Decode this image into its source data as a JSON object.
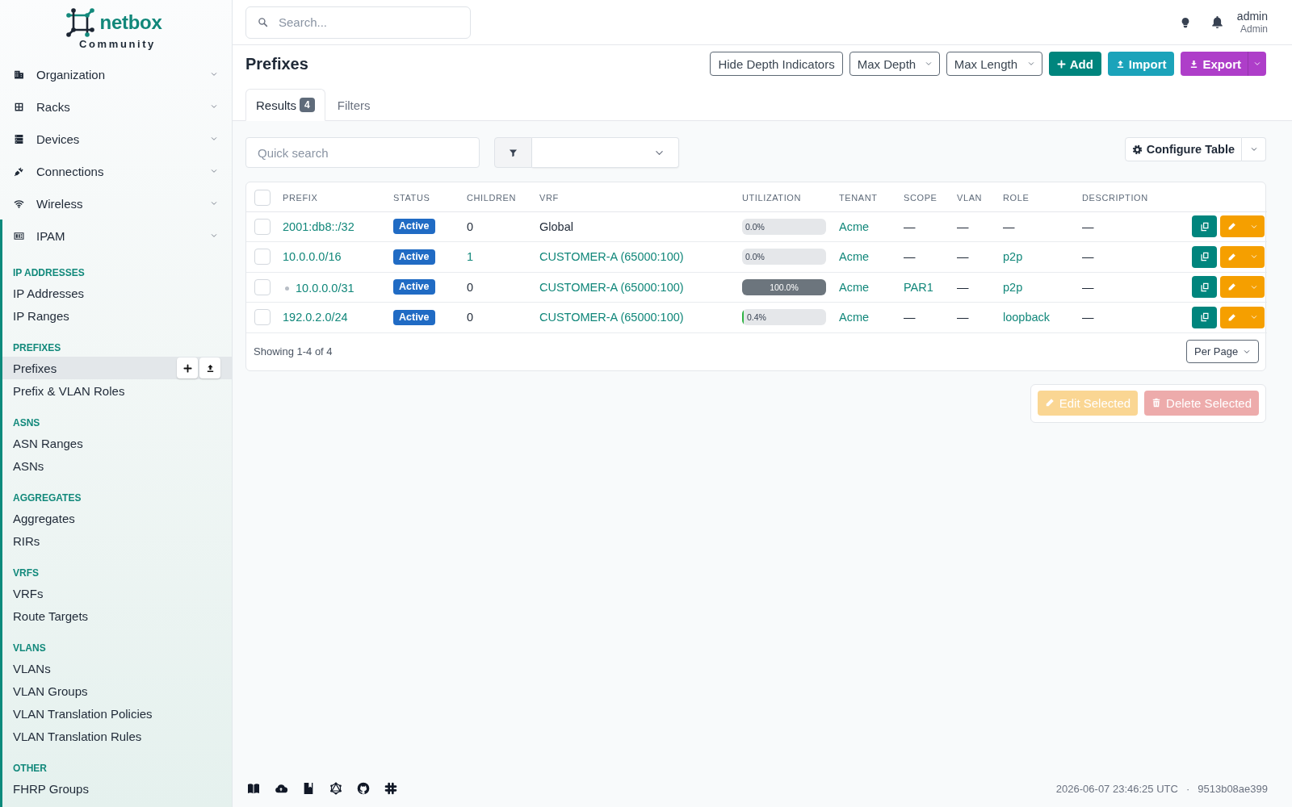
{
  "sidebar": {
    "logo": {
      "name": "netbox",
      "edition": "Community"
    },
    "menu": [
      {
        "label": "Organization",
        "expanded": false
      },
      {
        "label": "Racks",
        "expanded": false
      },
      {
        "label": "Devices",
        "expanded": false
      },
      {
        "label": "Connections",
        "expanded": false
      },
      {
        "label": "Wireless",
        "expanded": false
      },
      {
        "label": "IPAM",
        "expanded": true,
        "sections": [
          {
            "title": "IP ADDRESSES",
            "items": [
              {
                "label": "IP Addresses",
                "selected": false
              },
              {
                "label": "IP Ranges",
                "selected": false
              }
            ]
          },
          {
            "title": "PREFIXES",
            "items": [
              {
                "label": "Prefixes",
                "selected": true
              },
              {
                "label": "Prefix & VLAN Roles",
                "selected": false
              }
            ]
          },
          {
            "title": "ASNS",
            "items": [
              {
                "label": "ASN Ranges",
                "selected": false
              },
              {
                "label": "ASNs",
                "selected": false
              }
            ]
          },
          {
            "title": "AGGREGATES",
            "items": [
              {
                "label": "Aggregates",
                "selected": false
              },
              {
                "label": "RIRs",
                "selected": false
              }
            ]
          },
          {
            "title": "VRFS",
            "items": [
              {
                "label": "VRFs",
                "selected": false
              },
              {
                "label": "Route Targets",
                "selected": false
              }
            ]
          },
          {
            "title": "VLANS",
            "items": [
              {
                "label": "VLANs",
                "selected": false
              },
              {
                "label": "VLAN Groups",
                "selected": false
              },
              {
                "label": "VLAN Translation Policies",
                "selected": false
              },
              {
                "label": "VLAN Translation Rules",
                "selected": false
              }
            ]
          },
          {
            "title": "OTHER",
            "items": [
              {
                "label": "FHRP Groups",
                "selected": false
              }
            ]
          }
        ]
      }
    ]
  },
  "header": {
    "search": {
      "placeholder": "Search..."
    },
    "user": {
      "name": "admin",
      "role": "Admin"
    }
  },
  "page": {
    "title": "Prefixes",
    "actions": [
      {
        "kind": "toggle",
        "label": "Hide Depth Indicators"
      },
      {
        "kind": "select",
        "label": "Max Depth"
      },
      {
        "kind": "select",
        "label": "Max Length"
      },
      {
        "kind": "add",
        "label": "Add"
      },
      {
        "kind": "import",
        "label": "Import"
      },
      {
        "kind": "export",
        "label": "Export"
      }
    ],
    "tabs": [
      {
        "label": "Results",
        "badge": "4",
        "selected": true
      },
      {
        "label": "Filters",
        "selected": false
      }
    ]
  },
  "toolbar": {
    "quick_search": {
      "placeholder": "Quick search"
    },
    "configure": "Configure Table"
  },
  "table": {
    "select_all": {
      "checked": false
    },
    "columns": [
      "PREFIX",
      "STATUS",
      "CHILDREN",
      "VRF",
      "UTILIZATION",
      "TENANT",
      "SCOPE",
      "VLAN",
      "ROLE",
      "DESCRIPTION"
    ],
    "rows": [
      {
        "selected": false,
        "prefix": "2001:db8::/32",
        "status": "Active",
        "child_count": {
          "text": "0",
          "link": false
        },
        "vrf": {
          "text": "Global",
          "link": false
        },
        "utilization": {
          "reading": "0.0%"
        },
        "tenant": {
          "text": "Acme",
          "link": true
        },
        "scope": {
          "text": "—",
          "link": false
        },
        "vlan": {
          "text": "—",
          "link": false
        },
        "role": {
          "text": "—",
          "link": false
        },
        "description": {
          "text": "—",
          "link": false
        }
      },
      {
        "selected": false,
        "prefix": "10.0.0.0/16",
        "status": "Active",
        "child_count": {
          "text": "1",
          "link": true
        },
        "vrf": {
          "text": "CUSTOMER-A (65000:100)",
          "link": true
        },
        "utilization": {
          "reading": "0.0%"
        },
        "tenant": {
          "text": "Acme",
          "link": true
        },
        "scope": {
          "text": "—",
          "link": false
        },
        "vlan": {
          "text": "—",
          "link": false
        },
        "role": {
          "text": "p2p",
          "link": true
        },
        "description": {
          "text": "—",
          "link": false
        },
        "children": [
          {
            "selected": false,
            "prefix": "10.0.0.0/31",
            "status": "Active",
            "child_count": {
              "text": "0",
              "link": false
            },
            "vrf": {
              "text": "CUSTOMER-A (65000:100)",
              "link": true
            },
            "utilization": {
              "level": 1,
              "reading": "100.0%",
              "color": "#6c757d"
            },
            "tenant": {
              "text": "Acme",
              "link": true
            },
            "scope": {
              "text": "PAR1",
              "link": true
            },
            "vlan": {
              "text": "—",
              "link": false
            },
            "role": {
              "text": "p2p",
              "link": true
            },
            "description": {
              "text": "—",
              "link": false
            }
          }
        ]
      },
      {
        "selected": false,
        "prefix": "192.0.2.0/24",
        "status": "Active",
        "child_count": {
          "text": "0",
          "link": false
        },
        "vrf": {
          "text": "CUSTOMER-A (65000:100)",
          "link": true
        },
        "utilization": {
          "level": 0.004,
          "reading": "0.4%",
          "color": "#2fb344"
        },
        "tenant": {
          "text": "Acme",
          "link": true
        },
        "scope": {
          "text": "—",
          "link": false
        },
        "vlan": {
          "text": "—",
          "link": false
        },
        "role": {
          "text": "loopback",
          "link": true
        },
        "description": {
          "text": "—",
          "link": false
        }
      }
    ],
    "summary": "Showing 1-4 of 4",
    "per_page": "Per Page"
  },
  "bulk_actions": [
    {
      "kind": "edit",
      "label": "Edit Selected",
      "disabled": true
    },
    {
      "kind": "delete",
      "label": "Delete Selected",
      "disabled": true
    }
  ],
  "footer": {
    "timestamp": "2026-06-07 23:46:25 UTC",
    "separator": "·",
    "version": "9513b08ae399"
  }
}
